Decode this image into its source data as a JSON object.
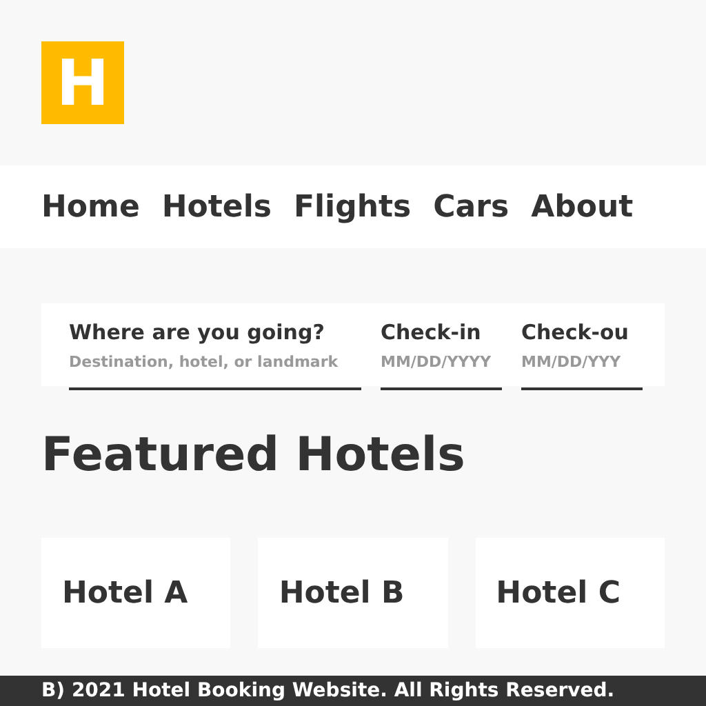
{
  "logo": {
    "letter": "H"
  },
  "nav": {
    "items": [
      {
        "label": "Home"
      },
      {
        "label": "Hotels"
      },
      {
        "label": "Flights"
      },
      {
        "label": "Cars"
      },
      {
        "label": "About"
      }
    ]
  },
  "search": {
    "fields": [
      {
        "label": "Where are you going?",
        "placeholder": "Destination, hotel, or landmark"
      },
      {
        "label": "Check-in",
        "placeholder": "MM/DD/YYYY"
      },
      {
        "label": "Check-ou",
        "placeholder": "MM/DD/YYY"
      }
    ]
  },
  "featured": {
    "title": "Featured Hotels",
    "hotels": [
      {
        "name": "Hotel A"
      },
      {
        "name": "Hotel B"
      },
      {
        "name": "Hotel C"
      }
    ]
  },
  "footer": {
    "text": "B) 2021 Hotel Booking Website. All Rights Reserved."
  }
}
